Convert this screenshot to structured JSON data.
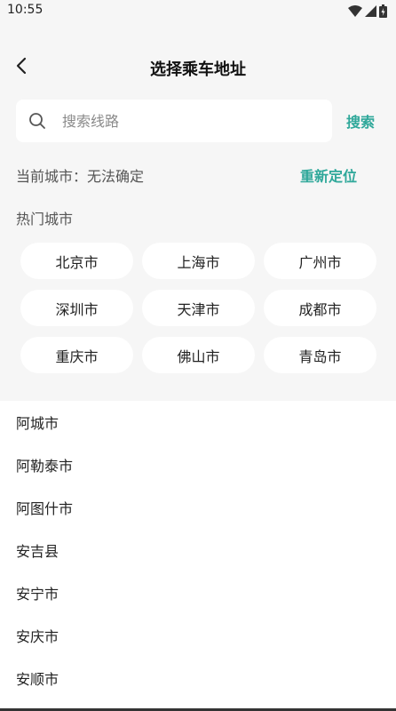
{
  "status_bar": {
    "time": "10:55",
    "icons": [
      "wifi-icon",
      "signal-icon",
      "battery-icon"
    ]
  },
  "header": {
    "title": "选择乘车地址",
    "back_icon": "chevron-left-icon"
  },
  "search": {
    "placeholder": "搜索线路",
    "value": "",
    "button_label": "搜索"
  },
  "location": {
    "current_label": "当前城市：无法确定",
    "relocate_label": "重新定位"
  },
  "hot_cities": {
    "title": "热门城市",
    "items": [
      "北京市",
      "上海市",
      "广州市",
      "深圳市",
      "天津市",
      "成都市",
      "重庆市",
      "佛山市",
      "青岛市"
    ]
  },
  "city_list": {
    "items": [
      "阿城市",
      "阿勒泰市",
      "阿图什市",
      "安吉县",
      "安宁市",
      "安庆市",
      "安顺市"
    ]
  },
  "colors": {
    "accent": "#2fa89a",
    "panel_bg": "#f6f6f6",
    "card_bg": "#ffffff"
  }
}
